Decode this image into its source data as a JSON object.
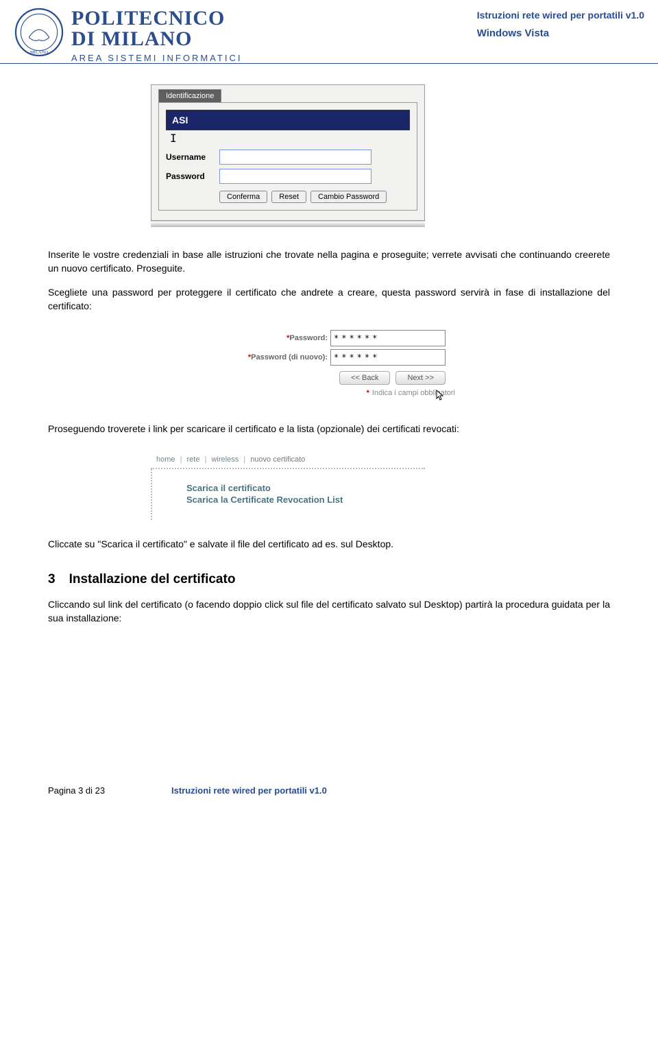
{
  "header": {
    "institution_line1": "POLITECNICO",
    "institution_line2": "DI MILANO",
    "asi": "AREA SISTEMI INFORMATICI",
    "doc_title": "Istruzioni rete wired per portatili v1.0",
    "doc_subtitle": "Windows Vista"
  },
  "shot1": {
    "tab": "Identificazione",
    "bar": "ASI",
    "caret": "I",
    "username_label": "Username",
    "password_label": "Password",
    "btn_confirm": "Conferma",
    "btn_reset": "Reset",
    "btn_changepw": "Cambio Password"
  },
  "para1": "Inserite le vostre credenziali in base alle istruzioni che trovate nella pagina e proseguite; verrete avvisati che continuando creerete un nuovo certificato. Proseguite.",
  "para2": "Scegliete una password per proteggere il certificato che andrete a creare, questa password servirà in fase di installazione del certificato:",
  "shot2": {
    "pw1_label": "Password:",
    "pw2_label": "Password (di nuovo):",
    "mask": "******",
    "btn_back": "<< Back",
    "btn_next": "Next >>",
    "note": "Indica i campi obbligatori",
    "asterisk": "*"
  },
  "para3": "Proseguendo troverete i link per scaricare il certificato e la lista (opzionale) dei certificati revocati:",
  "shot3": {
    "crumb_home": "home",
    "crumb_rete": "rete",
    "crumb_wireless": "wireless",
    "crumb_current": "nuovo certificato",
    "sep": "|",
    "link1": "Scarica il certificato",
    "link2": "Scarica la Certificate Revocation List"
  },
  "para4": "Cliccate su \"Scarica il certificato\" e salvate il file del certificato ad es. sul Desktop.",
  "section": {
    "num": "3",
    "title": "Installazione del certificato"
  },
  "para5": "Cliccando sul link del certificato (o facendo doppio click sul file del certificato salvato sul Desktop) partirà la procedura guidata per la sua installazione:",
  "footer": {
    "left": "Pagina 3 di 23",
    "right": "Istruzioni rete wired per portatili v1.0"
  }
}
